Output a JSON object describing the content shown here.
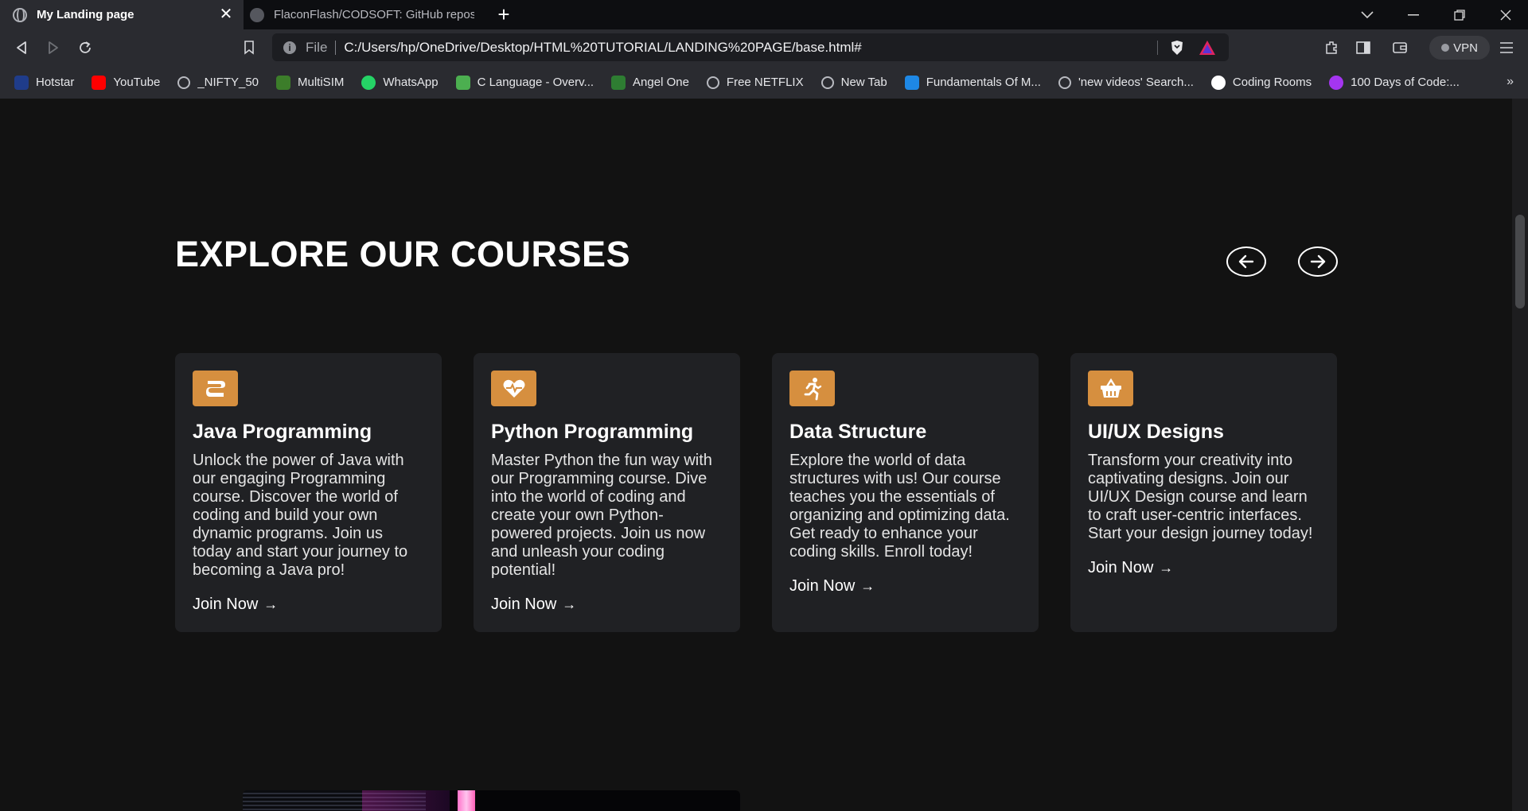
{
  "tabs": [
    {
      "title": "My Landing page",
      "active": true
    },
    {
      "title": "FlaconFlash/CODSOFT: GitHub reposit",
      "active": false
    }
  ],
  "address_bar": {
    "scheme_label": "File",
    "url": "C:/Users/hp/OneDrive/Desktop/HTML%20TUTORIAL/LANDING%20PAGE/base.html#"
  },
  "vpn_label": "VPN",
  "bookmarks": [
    {
      "label": "Hotstar",
      "icon": "hotstar-icon",
      "color": "#1f3c8a"
    },
    {
      "label": "YouTube",
      "icon": "youtube-icon",
      "color": "#ff0000"
    },
    {
      "label": "_NIFTY_50",
      "icon": "globe-icon",
      "color": "#5a5c62"
    },
    {
      "label": "MultiSIM",
      "icon": "multisim-icon",
      "color": "#3c7d2a"
    },
    {
      "label": "WhatsApp",
      "icon": "whatsapp-icon",
      "color": "#25d366"
    },
    {
      "label": "C Language - Overv...",
      "icon": "tutorialspoint-icon",
      "color": "#4caf50"
    },
    {
      "label": "Angel One",
      "icon": "angel-one-icon",
      "color": "#2e7d32"
    },
    {
      "label": "Free NETFLIX",
      "icon": "globe-icon",
      "color": "#5a5c62"
    },
    {
      "label": "New Tab",
      "icon": "globe-icon",
      "color": "#5a5c62"
    },
    {
      "label": "Fundamentals Of M...",
      "icon": "scribd-icon",
      "color": "#1e88e5"
    },
    {
      "label": "'new videos' Search...",
      "icon": "globe-icon",
      "color": "#5a5c62"
    },
    {
      "label": "Coding Rooms",
      "icon": "coding-rooms-icon",
      "color": "#ffffff"
    },
    {
      "label": "100 Days of Code:...",
      "icon": "udemy-icon",
      "color": "#a435f0"
    }
  ],
  "page": {
    "section_title": "EXPLORE OUR COURSES",
    "accent_color": "#d68f3f",
    "cards": [
      {
        "icon": "java-icon",
        "title": "Java Programming",
        "description": "Unlock the power of Java with our engaging Programming course. Discover the world of coding and build your own dynamic programs. Join us today and start your journey to becoming a Java pro!",
        "cta": "Join Now"
      },
      {
        "icon": "heart-pulse-icon",
        "title": "Python Programming",
        "description": "Master Python the fun way with our Programming course. Dive into the world of coding and create your own Python-powered projects. Join us now and unleash your coding potential!",
        "cta": "Join Now"
      },
      {
        "icon": "running-person-icon",
        "title": "Data Structure",
        "description": "Explore the world of data structures with us! Our course teaches you the essentials of organizing and optimizing data. Get ready to enhance your coding skills. Enroll today!",
        "cta": "Join Now"
      },
      {
        "icon": "shopping-basket-icon",
        "title": "UI/UX Designs",
        "description": "Transform your creativity into captivating designs. Join our UI/UX Design course and learn to craft user-centric interfaces. Start your design journey today!",
        "cta": "Join Now"
      }
    ]
  }
}
